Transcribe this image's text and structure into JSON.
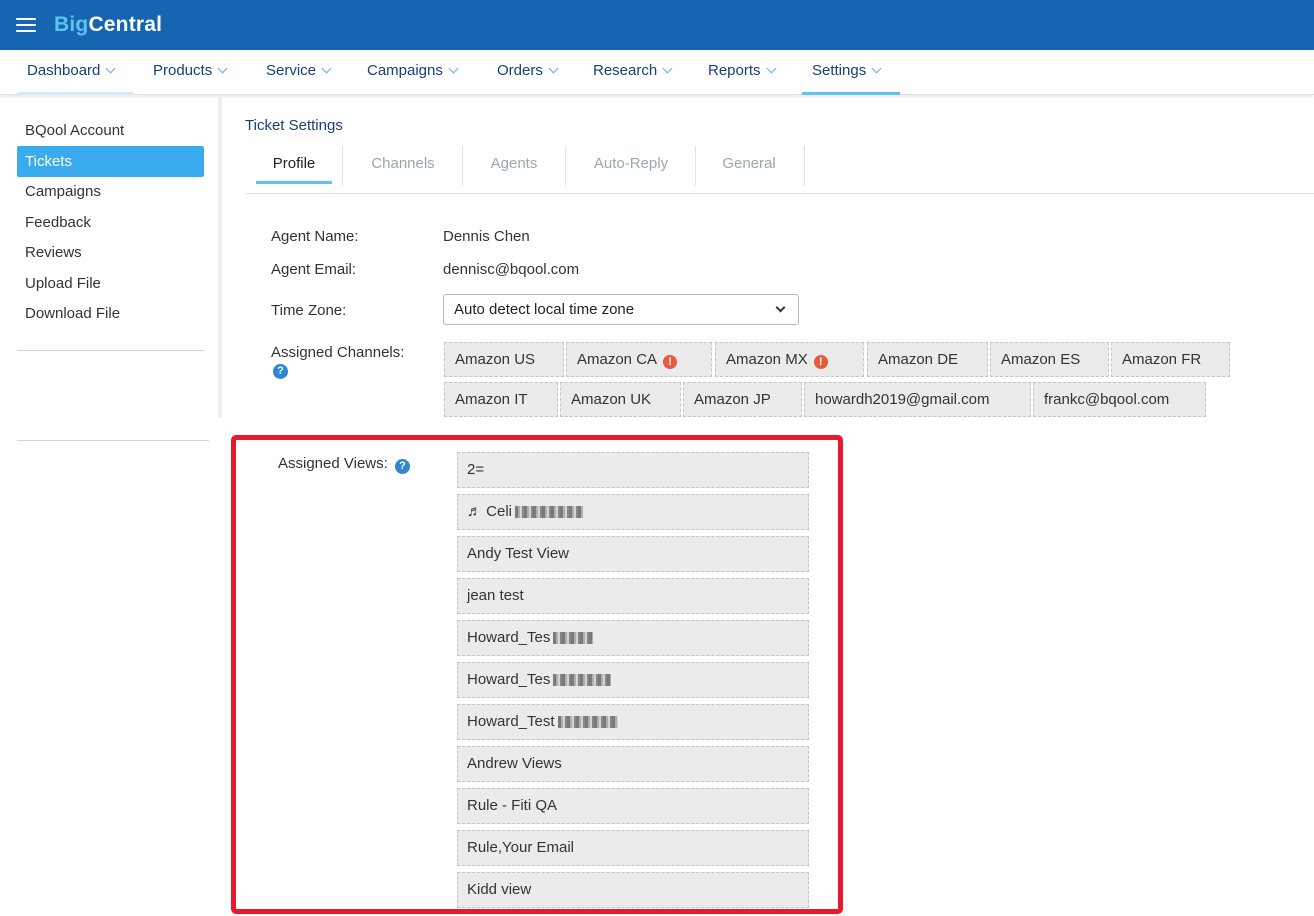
{
  "brand": {
    "part1": "Big",
    "part2": "Central"
  },
  "nav": [
    {
      "label": "Dashboard"
    },
    {
      "label": "Products"
    },
    {
      "label": "Service"
    },
    {
      "label": "Campaigns"
    },
    {
      "label": "Orders"
    },
    {
      "label": "Research"
    },
    {
      "label": "Reports"
    },
    {
      "label": "Settings"
    }
  ],
  "sidebar": {
    "items": [
      {
        "label": "BQool Account"
      },
      {
        "label": "Tickets"
      },
      {
        "label": "Campaigns"
      },
      {
        "label": "Feedback"
      },
      {
        "label": "Reviews"
      },
      {
        "label": "Upload File"
      },
      {
        "label": "Download File"
      }
    ],
    "active": "Tickets"
  },
  "page": {
    "title": "Ticket Settings"
  },
  "tabs": [
    {
      "label": "Profile"
    },
    {
      "label": "Channels"
    },
    {
      "label": "Agents"
    },
    {
      "label": "Auto-Reply"
    },
    {
      "label": "General"
    }
  ],
  "profile": {
    "agent_name_label": "Agent Name:",
    "agent_name": "Dennis Chen",
    "agent_email_label": "Agent Email:",
    "agent_email": "dennisc@bqool.com",
    "timezone_label": "Time Zone:",
    "timezone_value": "Auto detect local time zone",
    "channels_label": "Assigned Channels:",
    "views_label": "Assigned Views:"
  },
  "channels": [
    {
      "label": "Amazon US",
      "warning": false
    },
    {
      "label": "Amazon CA",
      "warning": true
    },
    {
      "label": "Amazon MX",
      "warning": true
    },
    {
      "label": "Amazon DE",
      "warning": false
    },
    {
      "label": "Amazon ES",
      "warning": false
    },
    {
      "label": "Amazon FR",
      "warning": false
    },
    {
      "label": "Amazon IT",
      "warning": false
    },
    {
      "label": "Amazon UK",
      "warning": false
    },
    {
      "label": "Amazon JP",
      "warning": false
    },
    {
      "label": "howardh2019@gmail.com",
      "warning": false
    },
    {
      "label": "frankc@bqool.com",
      "warning": false
    }
  ],
  "views": [
    {
      "label": "2="
    },
    {
      "label": "♬ Celi"
    },
    {
      "label": "Andy Test View"
    },
    {
      "label": "jean test"
    },
    {
      "label": "Howard_Tes"
    },
    {
      "label": "Howard_Tes"
    },
    {
      "label": "Howard_Test"
    },
    {
      "label": "Andrew Views"
    },
    {
      "label": "Rule - Fiti QA"
    },
    {
      "label": "Rule,Your Email"
    },
    {
      "label": "Kidd view"
    }
  ],
  "icons": {
    "menu": "hamburger-menu-icon",
    "help": "question-circle-icon",
    "warning": "exclamation-circle-icon"
  },
  "colors": {
    "topbar": "#1565b0",
    "accent": "#3aabed",
    "highlight": "#e8192c",
    "warning": "#ea5a3d"
  }
}
